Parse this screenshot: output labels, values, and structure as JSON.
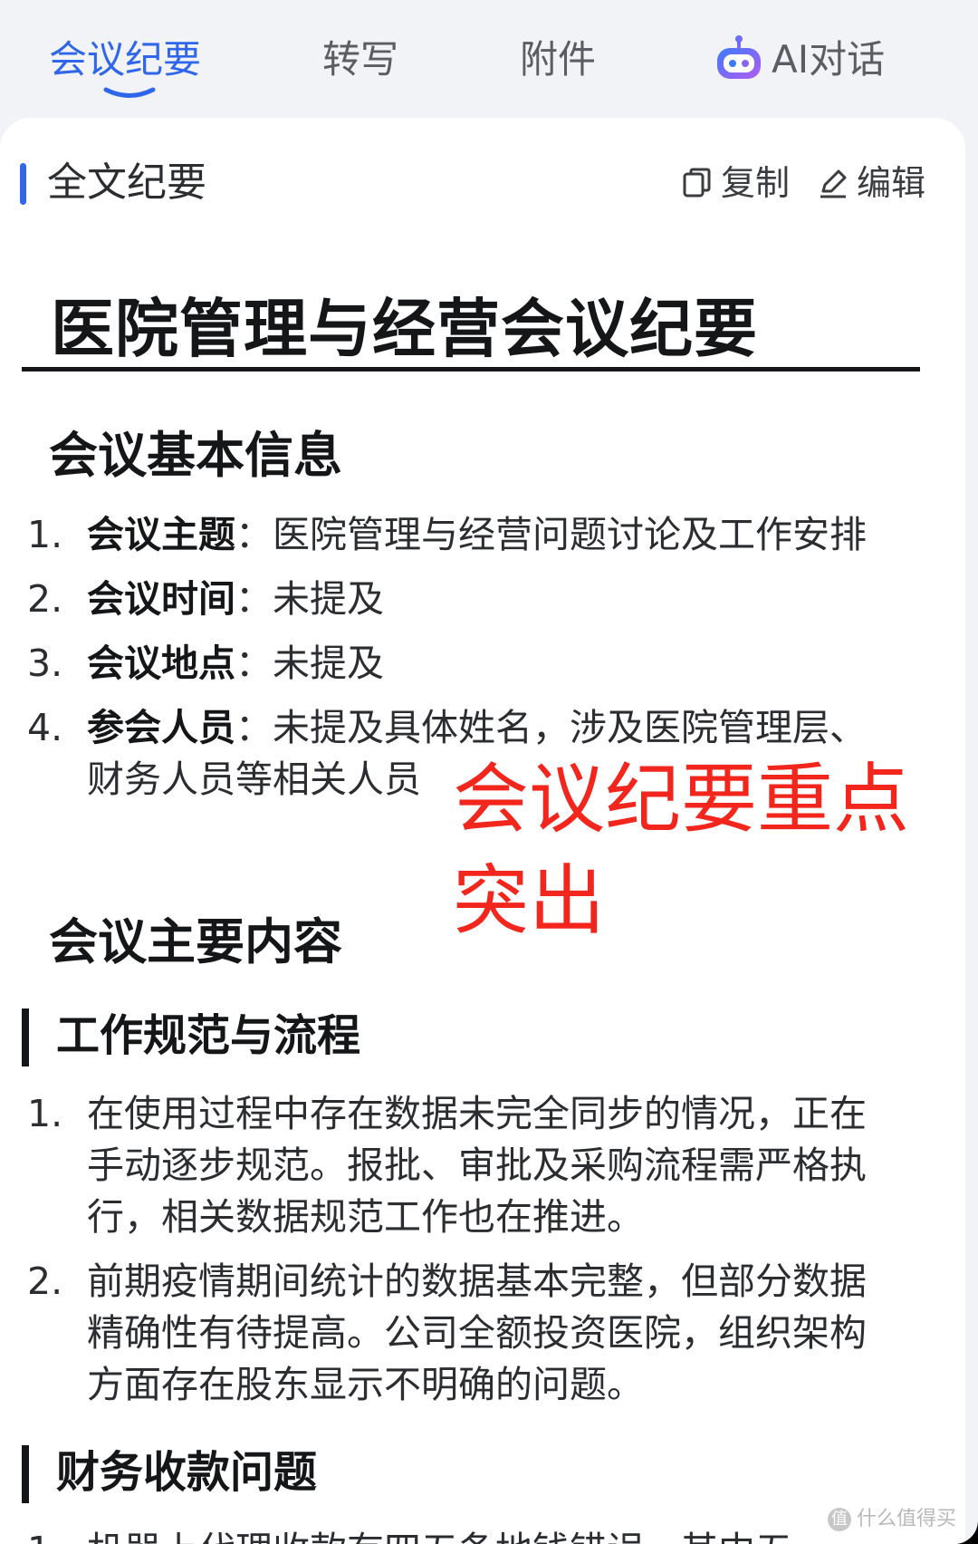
{
  "tabs": [
    {
      "label": "会议纪要",
      "active": true
    },
    {
      "label": "转写",
      "active": false
    },
    {
      "label": "附件",
      "active": false
    },
    {
      "label": "AI对话",
      "active": false,
      "icon": "robot-icon"
    }
  ],
  "colors": {
    "accent": "#2f66ea",
    "annotation": "#f2261c",
    "text": "#151618",
    "background": "#f2f3f6"
  },
  "section": {
    "label": "全文纪要",
    "copy_label": "复制",
    "copy_icon": "copy-icon",
    "edit_label": "编辑",
    "edit_icon": "pencil-icon"
  },
  "doc": {
    "title": "医院管理与经营会议纪要",
    "basic_info": {
      "heading": "会议基本信息",
      "items": [
        {
          "num": "1.",
          "key": "会议主题",
          "sep": "：",
          "value": "医院管理与经营问题讨论及工作安排"
        },
        {
          "num": "2.",
          "key": "会议时间",
          "sep": "：",
          "value": "未提及"
        },
        {
          "num": "3.",
          "key": "会议地点",
          "sep": "：",
          "value": "未提及"
        },
        {
          "num": "4.",
          "key": "参会人员",
          "sep": "：",
          "value": "未提及具体姓名，涉及医院管理层、财务人员等相关人员"
        }
      ]
    },
    "main_content": {
      "heading": "会议主要内容",
      "workflow": {
        "heading": "工作规范与流程",
        "items": [
          {
            "num": "1.",
            "text": "在使用过程中存在数据未完全同步的情况，正在手动逐步规范。报批、审批及采购流程需严格执行，相关数据规范工作也在推进。"
          },
          {
            "num": "2.",
            "text": "前期疫情期间统计的数据基本完整，但部分数据精确性有待提高。公司全额投资医院，组织架构方面存在股东显示不明确的问题。"
          }
        ]
      },
      "finance": {
        "heading": "财务收款问题",
        "items": [
          {
            "num": "1.",
            "text": "机器上代理收款有四五条地钱错误，其中五"
          }
        ]
      }
    }
  },
  "annotation": "会议纪要重点突出",
  "watermark": "什么值得买"
}
